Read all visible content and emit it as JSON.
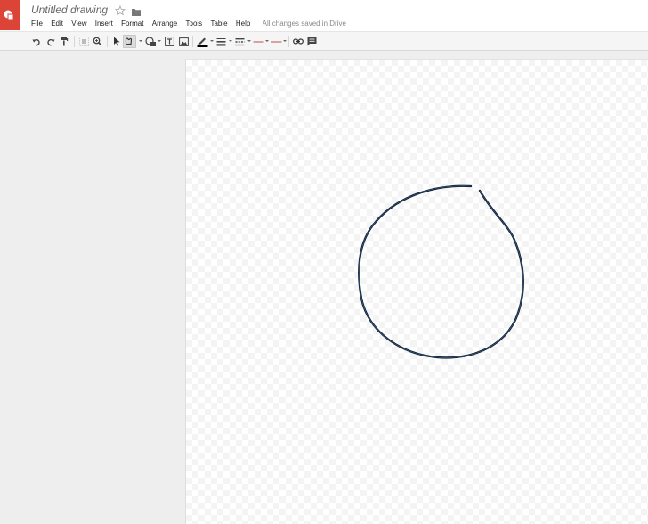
{
  "app": {
    "doc_title": "Untitled drawing",
    "save_status": "All changes saved in Drive",
    "brand_color": "#db4437"
  },
  "menu": {
    "items": [
      "File",
      "Edit",
      "View",
      "Insert",
      "Format",
      "Arrange",
      "Tools",
      "Table",
      "Help"
    ]
  },
  "toolbar": {
    "tools": [
      "undo-icon",
      "redo-icon",
      "paint-format-icon",
      "fit-icon",
      "zoom-icon",
      "select-icon",
      "shape-icon",
      "fill-icon",
      "textbox-icon",
      "image-icon",
      "line-color-icon",
      "line-weight-icon",
      "line-dash-icon",
      "line-start-icon",
      "line-end-icon",
      "link-icon",
      "comment-icon"
    ],
    "selected_tool": "shape-icon",
    "line_color": "#000000"
  },
  "drawing": {
    "stroke_color": "#0b1f3a",
    "shape": "freehand-circle"
  }
}
